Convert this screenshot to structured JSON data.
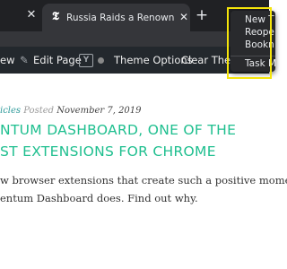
{
  "browser": {
    "tabs": [
      {
        "title": "Russia Raids a Renowned Phys",
        "favicon": "nyt-logo-icon"
      }
    ],
    "new_tab_symbol": "+",
    "close_symbol": "✕"
  },
  "context_menu": {
    "items": [
      {
        "label": "New T"
      },
      {
        "label": "Reope"
      },
      {
        "label": "Bookn"
      },
      {
        "label": "Task M"
      }
    ],
    "highlight_color": "#f5e50a"
  },
  "admin_bar": {
    "items": [
      {
        "label": "ew"
      },
      {
        "label": "Edit Page",
        "icon": "pencil-icon"
      },
      {
        "label": "Theme Options"
      },
      {
        "label": "Clear Theme"
      }
    ],
    "yoast_icon": "Y",
    "status_dot_color": "#888888"
  },
  "article": {
    "category": "icles",
    "posted_label": "Posted",
    "date": "November 7, 2019",
    "headline_lines": [
      "NTUM DASHBOARD, ONE OF THE",
      "ST EXTENSIONS FOR CHROME"
    ],
    "body_lines": [
      "w browser extensions that create such a positive mome",
      "entum Dashboard does. Find out why."
    ],
    "accent_color": "#1fbf8f"
  }
}
